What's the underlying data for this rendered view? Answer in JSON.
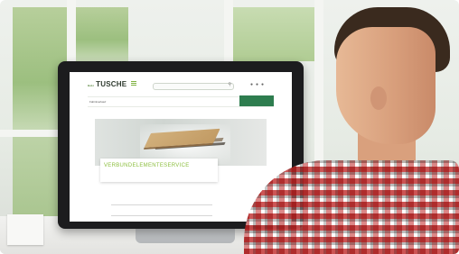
{
  "website": {
    "logo": {
      "small": "Holz",
      "name": "TUSCHE"
    },
    "nav_items": [
      "Fabrikverkauf",
      "",
      "",
      "",
      "",
      ""
    ],
    "cta_label": "",
    "breadcrumb": [
      "",
      ""
    ],
    "hero_title": "VERBUNDELEMENTESERVICE",
    "hero_subtitle": "",
    "form_fields": [
      "",
      ""
    ],
    "colors": {
      "brand_green": "#2e7d4f",
      "accent_green": "#8cbf3f"
    }
  }
}
